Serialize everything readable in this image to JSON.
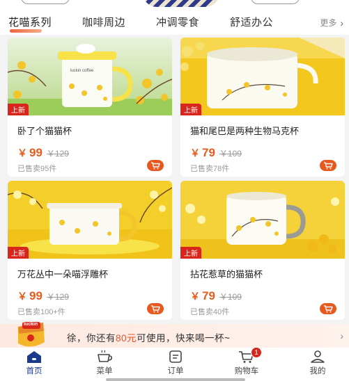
{
  "tabs": {
    "items": [
      {
        "label": "花喵系列"
      },
      {
        "label": "咖啡周边"
      },
      {
        "label": "冲调零食"
      },
      {
        "label": "舒适办公"
      }
    ],
    "more_label": "更多"
  },
  "products": [
    {
      "badge": "上新",
      "name": "卧了个猫猫杯",
      "price_symbol": "￥",
      "price": "99",
      "original_price": "￥129",
      "sold": "已售卖95件"
    },
    {
      "badge": "上新",
      "name": "猫和尾巴是两种生物马克杯",
      "price_symbol": "￥",
      "price": "79",
      "original_price": "￥109",
      "sold": "已售卖78件"
    },
    {
      "badge": "上新",
      "name": "万花丛中一朵喵浮雕杯",
      "price_symbol": "￥",
      "price": "99",
      "original_price": "￥129",
      "sold": "已售卖100+件"
    },
    {
      "badge": "上新",
      "name": "拈花惹草的猫猫杯",
      "price_symbol": "￥",
      "price": "79",
      "original_price": "￥109",
      "sold": "已售卖40件"
    }
  ],
  "product_images": {
    "mug1_text": "luckin coffee"
  },
  "coupon": {
    "mascot_text": "luckin",
    "prefix": "徐，你还有",
    "amount": "80元",
    "suffix": "可使用，快来喝一杯~"
  },
  "nav": {
    "items": [
      {
        "label": "首页",
        "icon": "home-icon",
        "active": true
      },
      {
        "label": "菜单",
        "icon": "cup-icon"
      },
      {
        "label": "订单",
        "icon": "order-icon"
      },
      {
        "label": "购物车",
        "icon": "cart-icon",
        "badge": "1"
      },
      {
        "label": "我的",
        "icon": "profile-icon"
      }
    ]
  },
  "colors": {
    "accent": "#e8591f",
    "badge_red": "#d9251c",
    "nav_active": "#1b3a8c"
  }
}
